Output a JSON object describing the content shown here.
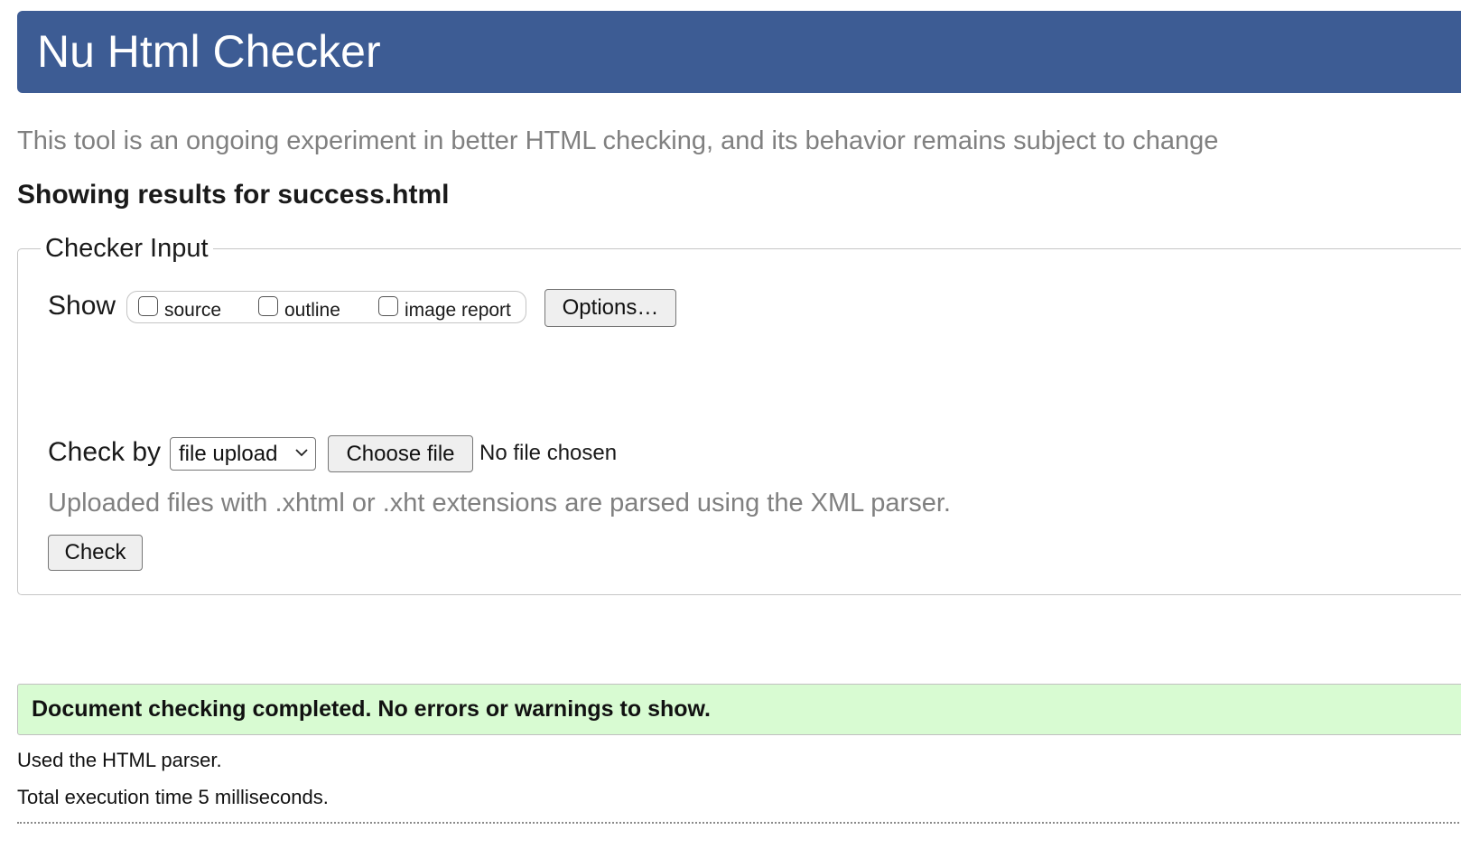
{
  "header": {
    "title": "Nu Html Checker",
    "background_color": "#3d5c94"
  },
  "subtitle": "This tool is an ongoing experiment in better HTML checking, and its behavior remains subject to change",
  "results_heading": "Showing results for success.html",
  "checker_input": {
    "legend": "Checker Input",
    "show": {
      "label": "Show",
      "checkboxes": [
        {
          "label": "source",
          "checked": false
        },
        {
          "label": "outline",
          "checked": false
        },
        {
          "label": "image report",
          "checked": false
        }
      ]
    },
    "options_button": "Options…",
    "check_by": {
      "label": "Check by",
      "selected": "file upload",
      "choose_file_button": "Choose file",
      "file_status": "No file chosen"
    },
    "hint": "Uploaded files with .xhtml or .xht extensions are parsed using the XML parser.",
    "check_button": "Check"
  },
  "result": {
    "message": "Document checking completed. No errors or warnings to show.",
    "background_color": "#d8fbd2"
  },
  "details": {
    "parser": "Used the HTML parser.",
    "execution_time": "Total execution time 5 milliseconds."
  }
}
